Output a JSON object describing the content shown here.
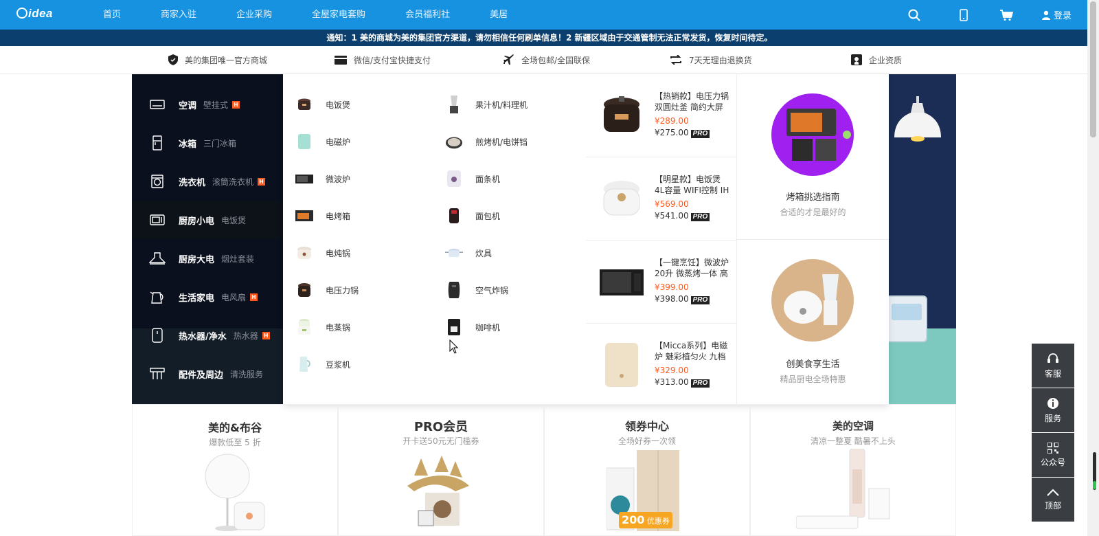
{
  "brand": {
    "logo_text": "idea"
  },
  "nav": {
    "links": [
      "首页",
      "商家入驻",
      "企业采购",
      "全屋家电套购",
      "会员福利社",
      "美居"
    ],
    "login_label": "登录"
  },
  "notice": "通知：1 美的商城为美的集团官方渠道，请勿相信任何刷单信息！2 新疆区域由于交通管制无法正常发货，恢复时间待定。",
  "services": [
    "美的集团唯一官方商城",
    "微信/支付宝快捷支付",
    "全场包邮/全国联保",
    "7天无理由退换货",
    "企业资质"
  ],
  "categories": [
    {
      "name": "空调",
      "sub": "壁挂式",
      "hot": true,
      "icon": "air-conditioner-icon"
    },
    {
      "name": "冰箱",
      "sub": "三门冰箱",
      "hot": false,
      "icon": "fridge-icon"
    },
    {
      "name": "洗衣机",
      "sub": "滚筒洗衣机",
      "hot": true,
      "icon": "washer-icon"
    },
    {
      "name": "厨房小电",
      "sub": "电饭煲",
      "hot": false,
      "icon": "microwave-icon"
    },
    {
      "name": "厨房大电",
      "sub": "烟灶套装",
      "hot": false,
      "icon": "range-hood-icon"
    },
    {
      "name": "生活家电",
      "sub": "电风扇",
      "hot": true,
      "icon": "kettle-icon"
    },
    {
      "name": "热水器/净水",
      "sub": "热水器",
      "hot": true,
      "icon": "water-heater-icon"
    },
    {
      "name": "配件及周边",
      "sub": "清洗服务",
      "hot": false,
      "icon": "accessory-icon"
    }
  ],
  "hot_badge": "H",
  "sub_col1": [
    "电饭煲",
    "电磁炉",
    "微波炉",
    "电烤箱",
    "电炖锅",
    "电压力锅",
    "电蒸锅",
    "豆浆机"
  ],
  "sub_col2": [
    "果汁机/料理机",
    "煎烤机/电饼铛",
    "面条机",
    "面包机",
    "炊具",
    "空气炸锅",
    "咖啡机"
  ],
  "products": [
    {
      "title": "【热销款】电压力锅 双圆灶釜 简约大屏",
      "price": "¥289.00",
      "pro_price": "¥275.00"
    },
    {
      "title": "【明星款】电饭煲 4L容量 WIFI控制 IH",
      "price": "¥569.00",
      "pro_price": "¥541.00"
    },
    {
      "title": "【一键烹饪】微波炉 20升 微蒸烤一体 高",
      "price": "¥399.00",
      "pro_price": "¥398.00"
    },
    {
      "title": "【Micca系列】电磁炉 魅彩植匀火 九档",
      "price": "¥329.00",
      "pro_price": "¥313.00"
    }
  ],
  "pro_label": "PRO",
  "guides": [
    {
      "title": "烤箱挑选指南",
      "sub": "合适的才是最好的"
    },
    {
      "title": "创美食享生活",
      "sub": "精品厨电全场特惠"
    }
  ],
  "promos": [
    {
      "title": "美的&布谷",
      "sub": "爆款低至 5 折"
    },
    {
      "title": "PRO会员",
      "sub": "开卡送50元无门槛券"
    },
    {
      "title": "领券中心",
      "sub": "全场好券一次领",
      "coupon_amount": "200",
      "coupon_label": "优惠券"
    },
    {
      "title": "美的空调",
      "sub": "清凉一整夏  酷暑不上头"
    }
  ],
  "float_bar": [
    "客服",
    "服务",
    "公众号",
    "顶部"
  ]
}
